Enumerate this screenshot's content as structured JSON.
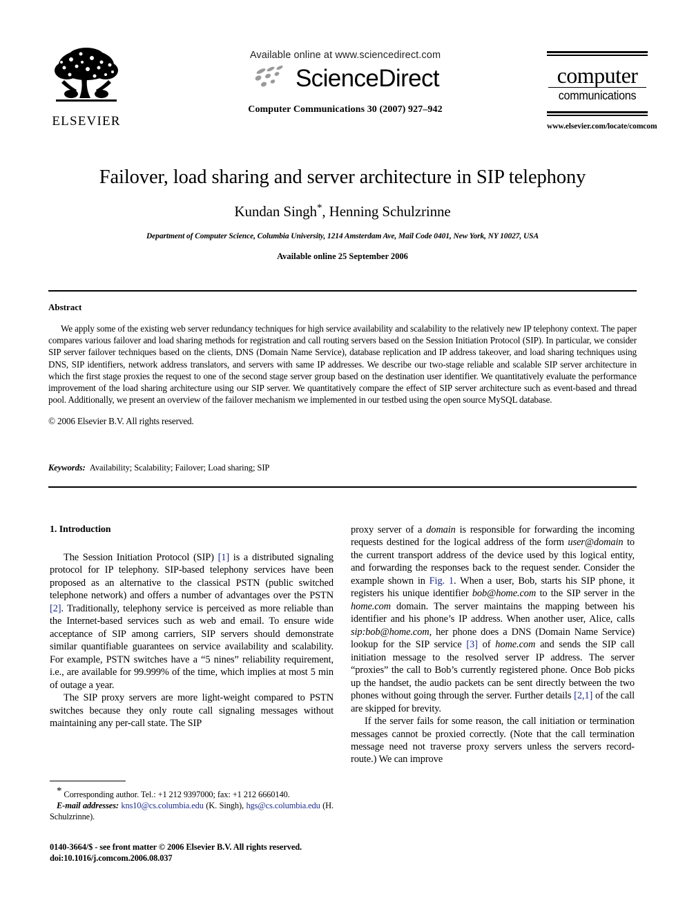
{
  "masthead": {
    "publisher_name": "ELSEVIER",
    "publisher_logo_icon": "elsevier-tree-icon",
    "available_online": "Available online at www.sciencedirect.com",
    "sciencedirect_wordmark": "ScienceDirect",
    "sciencedirect_logo_icon": "sciencedirect-swoosh-icon",
    "journal_reference": "Computer Communications 30 (2007) 927–942",
    "journal_logo": {
      "line1": "computer",
      "line2": "communications"
    },
    "journal_url": "www.elsevier.com/locate/comcom"
  },
  "title_block": {
    "title": "Failover, load sharing and server architecture in SIP telephony",
    "authors": "Kundan Singh",
    "author_star": "*",
    "authors_rest": ", Henning Schulzrinne",
    "affiliation": "Department of Computer Science, Columbia University, 1214 Amsterdam Ave, Mail Code 0401, New York, NY 10027, USA",
    "available_online": "Available online 25 September 2006"
  },
  "abstract": {
    "heading": "Abstract",
    "text": "We apply some of the existing web server redundancy techniques for high service availability and scalability to the relatively new IP telephony context. The paper compares various failover and load sharing methods for registration and call routing servers based on the Session Initiation Protocol (SIP). In particular, we consider SIP server failover techniques based on the clients, DNS (Domain Name Service), database replication and IP address takeover, and load sharing techniques using DNS, SIP identifiers, network address translators, and servers with same IP addresses. We describe our two-stage reliable and scalable SIP server architecture in which the first stage proxies the request to one of the second stage server group based on the destination user identifier. We quantitatively evaluate the performance improvement of the load sharing architecture using our SIP server. We quantitatively compare the effect of SIP server architecture such as event-based and thread pool. Additionally, we present an overview of the failover mechanism we implemented in our testbed using the open source MySQL database.",
    "copyright": "© 2006 Elsevier B.V. All rights reserved."
  },
  "keywords": {
    "label": "Keywords:",
    "value": "Availability; Scalability; Failover; Load sharing; SIP"
  },
  "body": {
    "section_heading": "1. Introduction",
    "left_column": {
      "paragraph_1_part1": "The Session Initiation Protocol (SIP) ",
      "paragraph_1_ref1": "[1]",
      "paragraph_1_part2": " is a distributed signaling protocol for IP telephony. SIP-based telephony services have been proposed as an alternative to the classical PSTN (public switched telephone network) and offers a number of advantages over the PSTN ",
      "paragraph_1_ref2": "[2]",
      "paragraph_1_part3": ". Traditionally, telephony service is perceived as more reliable than the Internet-based services such as web and email. To ensure wide acceptance of SIP among carriers, SIP servers should demonstrate similar quantifiable guarantees on service availability and scalability. For example, PSTN switches have a “5 nines” reliability requirement, i.e., are available for 99.999% of the time, which implies at most 5 min of outage a year.",
      "paragraph_2": "The SIP proxy servers are more light-weight compared to PSTN switches because they only route call signaling messages without maintaining any per-call state. The SIP"
    },
    "right_column": {
      "paragraph_1_part1": "proxy server of a ",
      "paragraph_1_em1": "domain",
      "paragraph_1_part2": " is responsible for forwarding the incoming requests destined for the logical address of the form ",
      "paragraph_1_em2": "user@domain",
      "paragraph_1_part3": " to the current transport address of the device used by this logical entity, and forwarding the responses back to the request sender. Consider the example shown in ",
      "paragraph_1_ref1": "Fig. 1",
      "paragraph_1_part4": ". When a user, Bob, starts his SIP phone, it registers his unique identifier ",
      "paragraph_1_em3": "bob@home.com",
      "paragraph_1_part5": " to the SIP server in the ",
      "paragraph_1_em4": "home.com",
      "paragraph_1_part6": " domain. The server maintains the mapping between his identifier and his phone’s IP address. When another user, Alice, calls ",
      "paragraph_1_em5": "sip:bob@home.com",
      "paragraph_1_part7": ", her phone does a DNS (Domain Name Service) lookup for the SIP service ",
      "paragraph_1_ref2": "[3]",
      "paragraph_1_part8": " of ",
      "paragraph_1_em6": "home.com",
      "paragraph_1_part9": " and sends the SIP call initiation message to the resolved server IP address. The server “proxies” the call to Bob’s currently registered phone. Once Bob picks up the handset, the audio packets can be sent directly between the two phones without going through the server. Further details ",
      "paragraph_1_ref3": "[2,1]",
      "paragraph_1_part10": " of the call are skipped for brevity.",
      "paragraph_2": "If the server fails for some reason, the call initiation or termination messages cannot be proxied correctly. (Note that the call termination message need not traverse proxy servers unless the servers record-route.) We can improve"
    }
  },
  "footnote": {
    "star": "*",
    "corresponding": "Corresponding author. Tel.: +1 212 9397000; fax: +1 212 6660140.",
    "email_label": "E-mail addresses:",
    "email1": "kns10@cs.columbia.edu",
    "email1_author": "(K. Singh)",
    "email2": "hgs@cs.columbia.edu",
    "email2_author": "(H. Schulzrinne)."
  },
  "frontmatter": {
    "line1": "0140-3664/$ - see front matter © 2006 Elsevier B.V. All rights reserved.",
    "doi": "doi:10.1016/j.comcom.2006.08.037"
  },
  "colors": {
    "link": "#1b2a8a",
    "text": "#000000",
    "background": "#ffffff"
  }
}
